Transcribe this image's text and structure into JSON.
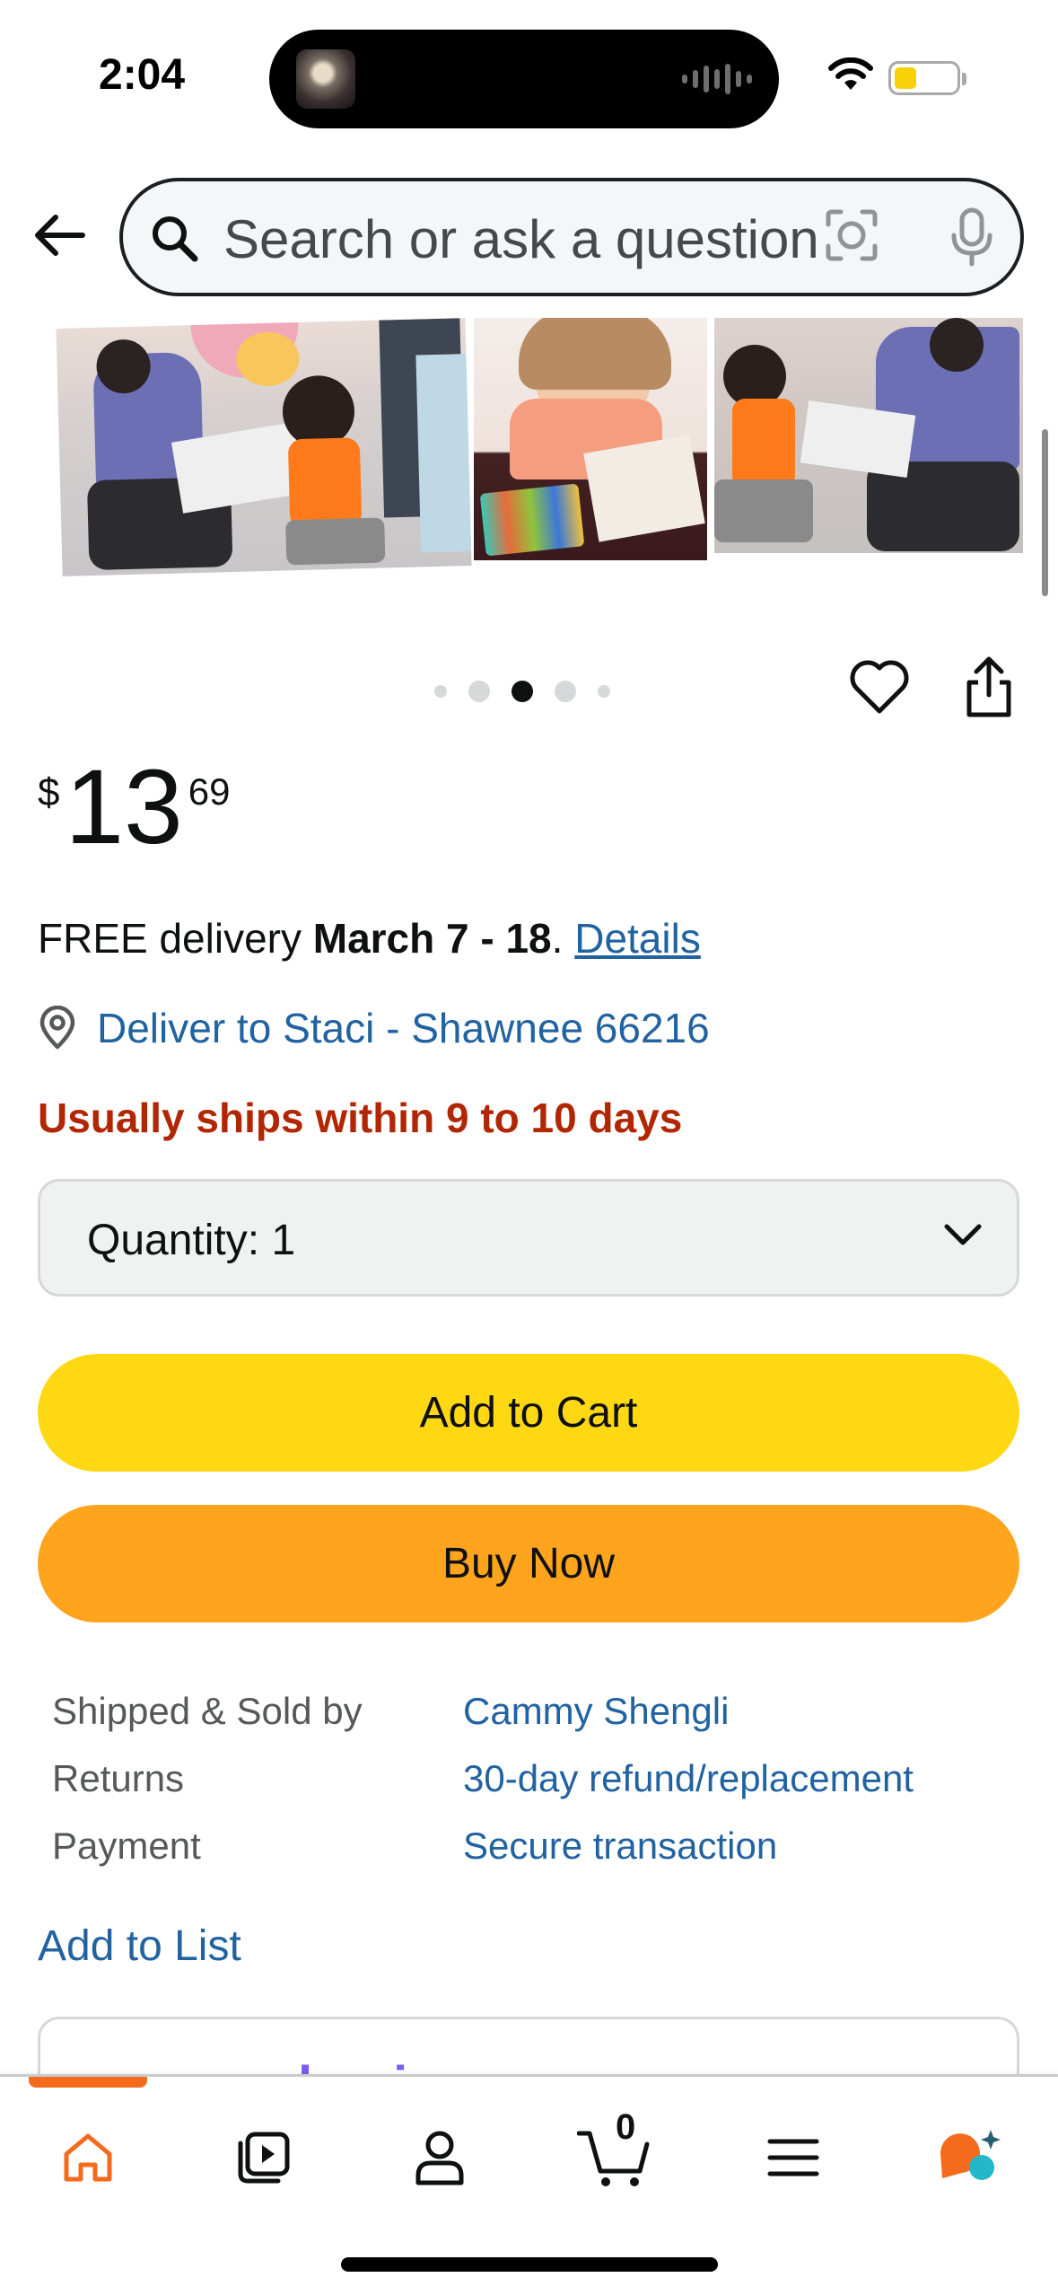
{
  "status_bar": {
    "time": "2:04"
  },
  "search": {
    "placeholder": "Search or ask a question"
  },
  "carousel": {
    "dot_count": 5,
    "active_dot": 3
  },
  "price": {
    "symbol": "$",
    "whole": "13",
    "fraction": "69"
  },
  "delivery": {
    "prefix": "FREE delivery ",
    "dates": "March 7 - 18",
    "suffix": ". ",
    "details_link": "Details"
  },
  "location": {
    "text": "Deliver to Staci - Shawnee 66216"
  },
  "shipping_note": "Usually ships within 9 to 10 days",
  "quantity": {
    "label": "Quantity:",
    "value": "1"
  },
  "buttons": {
    "add_to_cart": "Add to Cart",
    "buy_now": "Buy Now"
  },
  "info": {
    "rows": [
      {
        "key": "Shipped & Sold by",
        "value": "Cammy Shengli"
      },
      {
        "key": "Returns",
        "value": "30-day refund/replacement"
      },
      {
        "key": "Payment",
        "value": "Secure transaction"
      }
    ]
  },
  "add_to_list": "Add to List",
  "business_card": {
    "logo_text": "amazon business"
  },
  "bottom_nav": {
    "cart_count": "0",
    "items": [
      "home-icon",
      "video-icon",
      "account-icon",
      "cart-icon",
      "menu-icon",
      "rufus-icon"
    ]
  },
  "colors": {
    "link": "#2162a1",
    "add_to_cart": "#ffd814",
    "buy_now": "#ffa41c",
    "ships_note": "#b12704",
    "active_nav": "#f56b1e"
  }
}
